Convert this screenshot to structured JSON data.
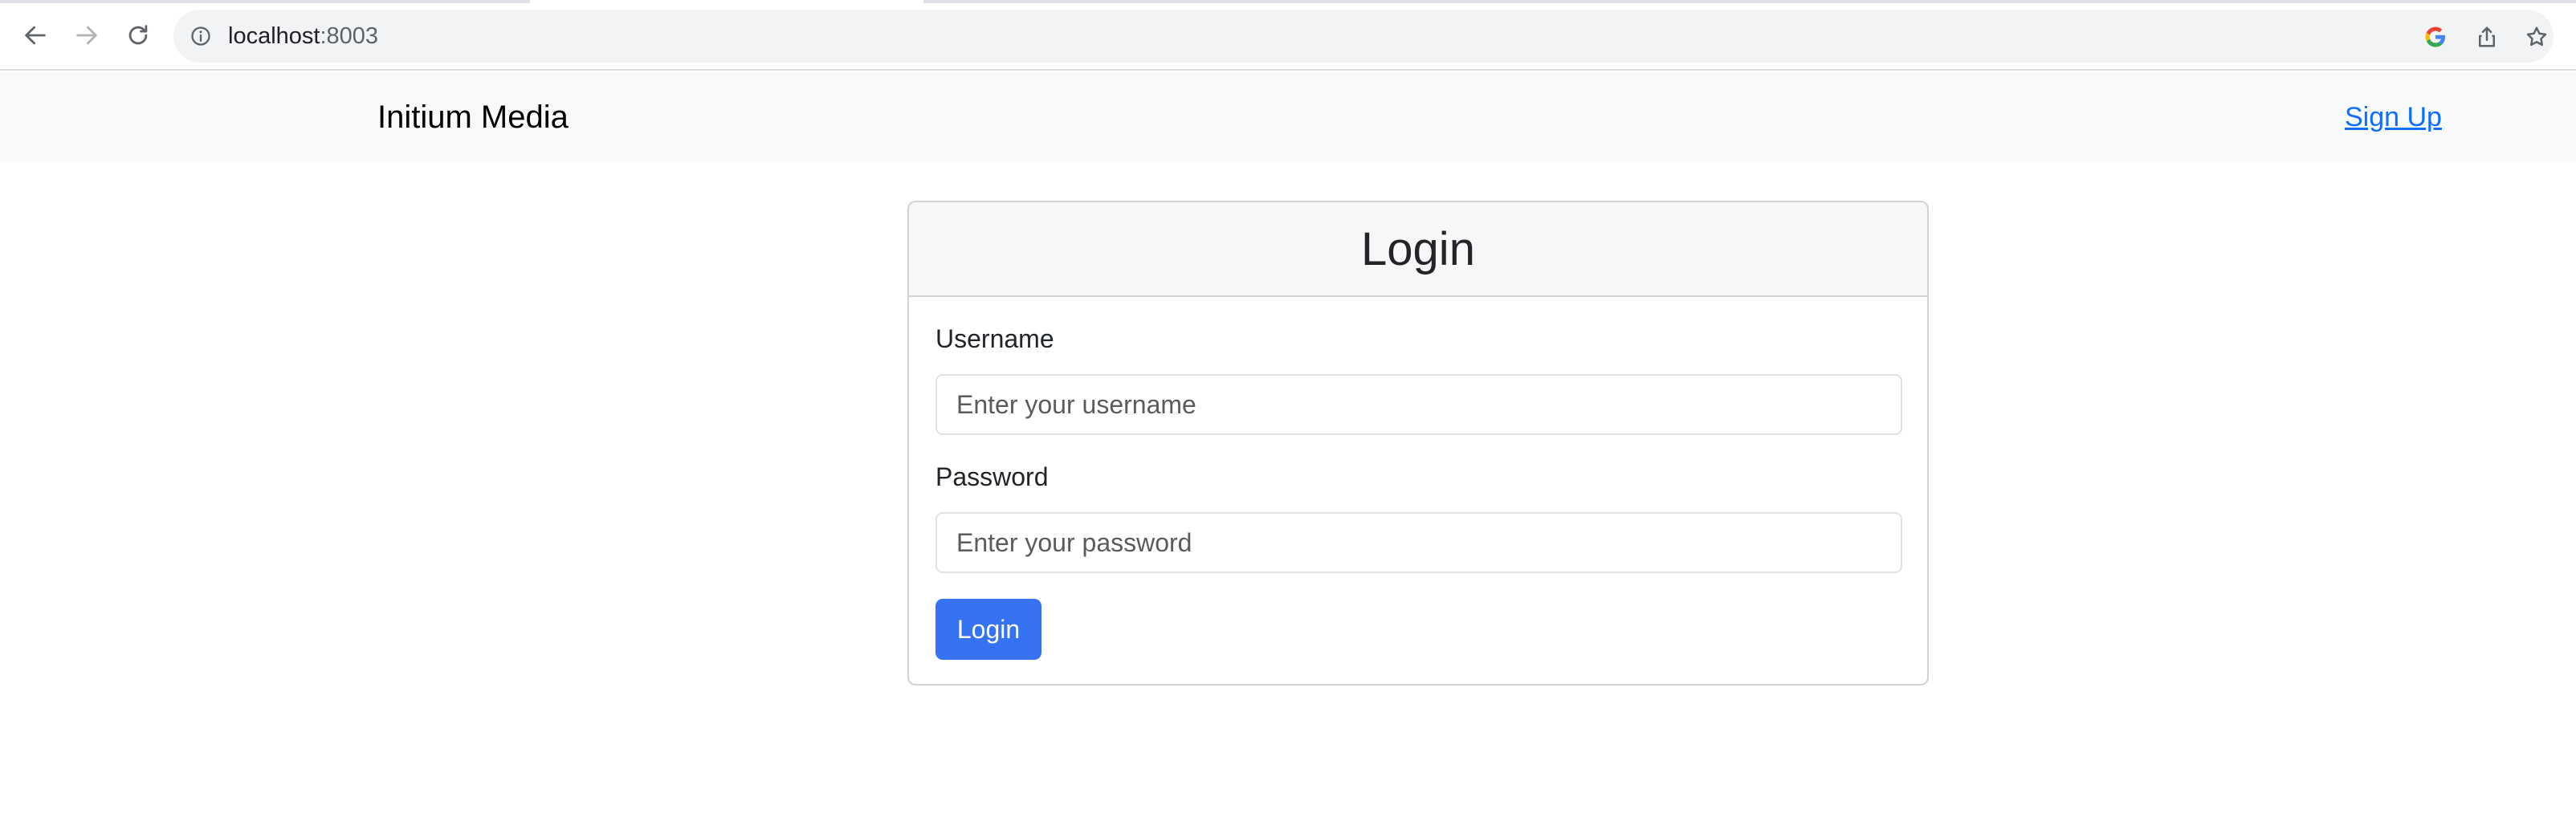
{
  "browser": {
    "url_host": "localhost",
    "url_port": ":8003",
    "icons": {
      "back": "arrow-left",
      "forward": "arrow-right",
      "reload": "reload",
      "site_info": "info-circle",
      "google": "google-g",
      "share": "share",
      "bookmark": "star"
    }
  },
  "navbar": {
    "brand": "Initium Media",
    "signup_label": "Sign Up"
  },
  "login_card": {
    "title": "Login",
    "username_label": "Username",
    "username_placeholder": "Enter your username",
    "password_label": "Password",
    "password_placeholder": "Enter your password",
    "submit_label": "Login"
  },
  "colors": {
    "primary": "#3573f3",
    "link": "#0d6efd",
    "navbar_bg": "#f8f9fa",
    "card_header_bg": "#f7f7f7"
  }
}
